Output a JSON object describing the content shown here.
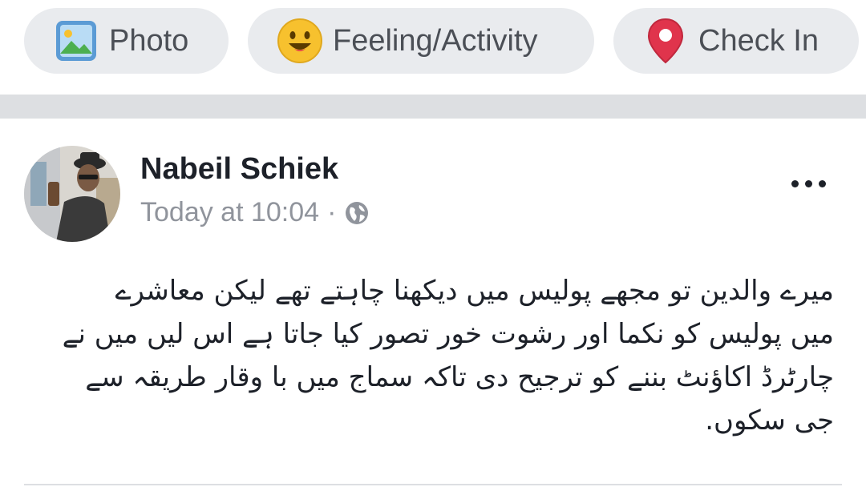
{
  "composer": {
    "photo_label": "Photo",
    "feeling_label": "Feeling/Activity",
    "checkin_label": "Check In",
    "icons": {
      "photo": "photo-icon",
      "feeling": "smiley-icon",
      "checkin": "map-pin-icon"
    }
  },
  "post": {
    "author": "Nabeil Schiek",
    "timestamp": "Today at 10:04",
    "separator": "·",
    "privacy_icon": "globe-icon",
    "body_lines": [
      "میرے والدین تو مجھے پولیس میں دیکھنا چاہتے تھے لیکن معاشرے",
      "میں پولیس کو نکما اور رشوت خور تصور کیا جاتا ہے اس لیں میں نے",
      "چارٹرڈ اکاؤنٹ بننے کو ترجیح دی تاکہ سماج میں با وقار طریقہ سے",
      "جی سکوں."
    ]
  },
  "colors": {
    "pill_bg": "#e9ebee",
    "divider": "#dddfe2",
    "secondary_text": "#90949c",
    "primary_text": "#1d2129",
    "pin_red": "#e0344c",
    "smiley_yellow": "#f7c12e",
    "photo_green": "#4caf50",
    "photo_blue": "#5b9bd5"
  }
}
